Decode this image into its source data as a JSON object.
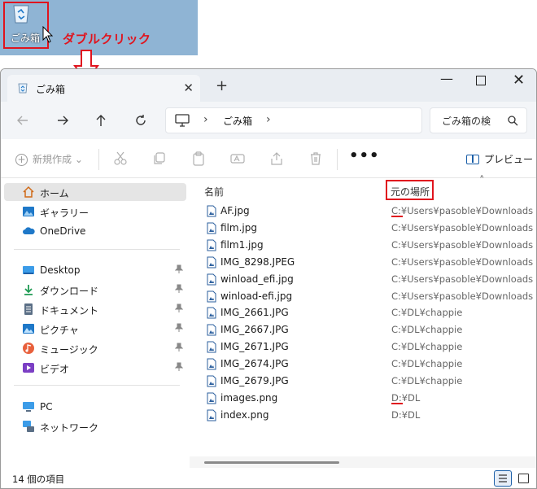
{
  "desktop": {
    "recycle_bin_label": "ごみ箱",
    "annotation": "ダブルクリック",
    "accent": "#e0141e"
  },
  "window": {
    "tab_title": "ごみ箱",
    "tab_close": "✕",
    "new_tab": "+",
    "minimize": "—",
    "close": "✕"
  },
  "nav": {
    "breadcrumb": "ごみ箱",
    "separator": "›",
    "search_placeholder": "ごみ箱の検"
  },
  "toolbar": {
    "new_label": "新規作成",
    "more_label": "•••",
    "preview_label": "プレビュー"
  },
  "sidebar": {
    "items": [
      {
        "label": "ホーム",
        "icon": "home-icon"
      },
      {
        "label": "ギャラリー",
        "icon": "gallery-icon"
      },
      {
        "label": "OneDrive",
        "icon": "cloud-icon"
      },
      {
        "label": "Desktop",
        "icon": "desktop-icon"
      },
      {
        "label": "ダウンロード",
        "icon": "download-icon"
      },
      {
        "label": "ドキュメント",
        "icon": "document-icon"
      },
      {
        "label": "ピクチャ",
        "icon": "pictures-icon"
      },
      {
        "label": "ミュージック",
        "icon": "music-icon"
      },
      {
        "label": "ビデオ",
        "icon": "video-icon"
      },
      {
        "label": "PC",
        "icon": "pc-icon"
      },
      {
        "label": "ネットワーク",
        "icon": "network-icon"
      }
    ]
  },
  "columns": {
    "name": "名前",
    "location": "元の場所"
  },
  "files": [
    {
      "name": "AF.jpg",
      "location": "C:¥Users¥pasoble¥Downloads"
    },
    {
      "name": "film.jpg",
      "location": "C:¥Users¥pasoble¥Downloads"
    },
    {
      "name": "film1.jpg",
      "location": "C:¥Users¥pasoble¥Downloads"
    },
    {
      "name": "IMG_8298.JPEG",
      "location": "C:¥Users¥pasoble¥Downloads"
    },
    {
      "name": "winload_efi.jpg",
      "location": "C:¥Users¥pasoble¥Downloads"
    },
    {
      "name": "winload-efi.jpg",
      "location": "C:¥Users¥pasoble¥Downloads"
    },
    {
      "name": "IMG_2661.JPG",
      "location": "C:¥DL¥chappie"
    },
    {
      "name": "IMG_2667.JPG",
      "location": "C:¥DL¥chappie"
    },
    {
      "name": "IMG_2671.JPG",
      "location": "C:¥DL¥chappie"
    },
    {
      "name": "IMG_2674.JPG",
      "location": "C:¥DL¥chappie"
    },
    {
      "name": "IMG_2679.JPG",
      "location": "C:¥DL¥chappie"
    },
    {
      "name": "images.png",
      "location": "D:¥DL"
    },
    {
      "name": "index.png",
      "location": "D:¥DL"
    }
  ],
  "status": {
    "count_text": "14 個の項目"
  }
}
